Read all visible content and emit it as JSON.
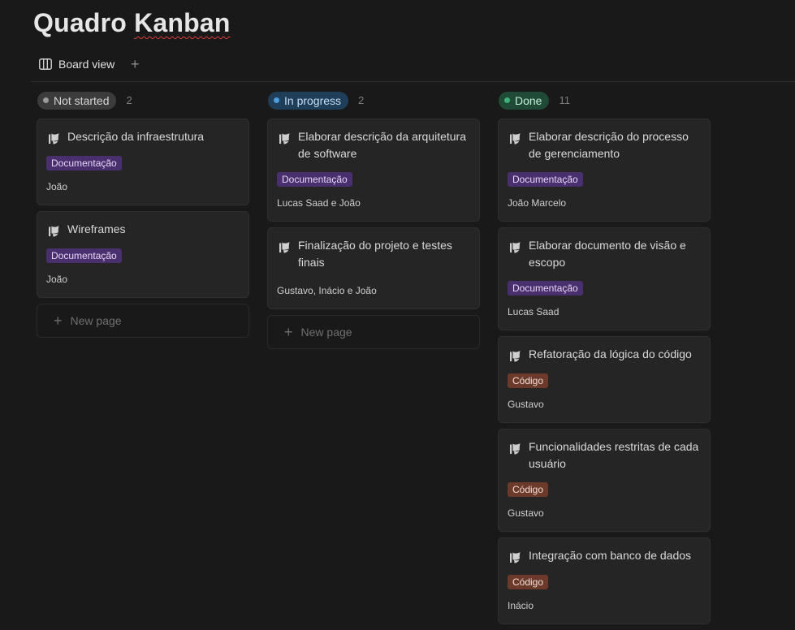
{
  "page": {
    "title_part1": "Quadro",
    "title_part2": "Kanban"
  },
  "view": {
    "label": "Board view",
    "icon": "board-view-icon",
    "add_label": "+"
  },
  "new_page_label": "New page",
  "columns": [
    {
      "status": "Not started",
      "count": "2",
      "color": "#9b9b9b",
      "cards": [
        {
          "title": "Descrição da infraestrutura",
          "tag": "Documentação",
          "tag_type": "doc",
          "person": "João"
        },
        {
          "title": "Wireframes",
          "tag": "Documentação",
          "tag_type": "doc",
          "person": "João"
        }
      ]
    },
    {
      "status": "In progress",
      "count": "2",
      "color": "#4c9bdc",
      "cards": [
        {
          "title": "Elaborar descrição da arquitetura de software",
          "tag": "Documentação",
          "tag_type": "doc",
          "person": "Lucas Saad e João"
        },
        {
          "title": "Finalização do projeto e testes finais",
          "tag": "",
          "tag_type": "",
          "person": "Gustavo, Inácio e João"
        }
      ]
    },
    {
      "status": "Done",
      "count": "11",
      "color": "#3fb07a",
      "cards": [
        {
          "title": "Elaborar descrição do processo de gerenciamento",
          "tag": "Documentação",
          "tag_type": "doc",
          "person": "João Marcelo"
        },
        {
          "title": "Elaborar documento de visão e escopo",
          "tag": "Documentação",
          "tag_type": "doc",
          "person": "Lucas Saad"
        },
        {
          "title": "Refatoração da lógica do código",
          "tag": "Código",
          "tag_type": "code",
          "person": "Gustavo"
        },
        {
          "title": "Funcionalidades restritas de cada usuário",
          "tag": "Código",
          "tag_type": "code",
          "person": "Gustavo"
        },
        {
          "title": "Integração com banco de dados",
          "tag": "Código",
          "tag_type": "code",
          "person": "Inácio"
        }
      ]
    }
  ]
}
